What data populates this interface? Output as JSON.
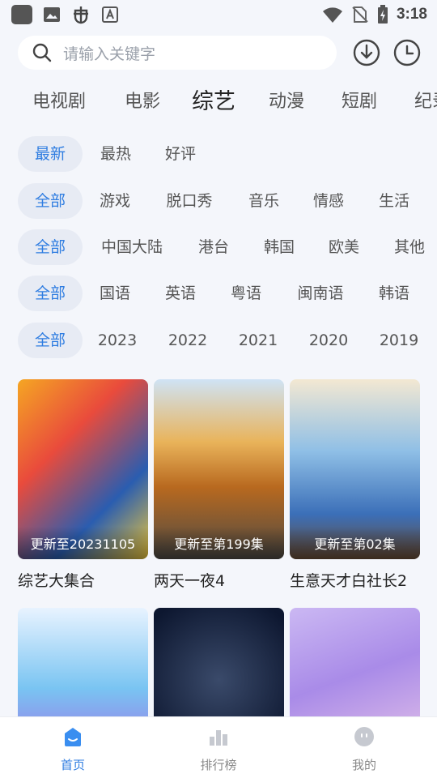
{
  "status_bar": {
    "time": "3:18"
  },
  "search": {
    "placeholder": "请输入关键字"
  },
  "category_tabs": [
    {
      "label": "电视剧"
    },
    {
      "label": "电影"
    },
    {
      "label": "综艺"
    },
    {
      "label": "动漫"
    },
    {
      "label": "短剧"
    },
    {
      "label": "纪录"
    }
  ],
  "active_category": "综艺",
  "filters": {
    "sort": [
      "最新",
      "最热",
      "好评"
    ],
    "genre": [
      "全部",
      "游戏",
      "脱口秀",
      "音乐",
      "情感",
      "生活"
    ],
    "region": [
      "全部",
      "中国大陆",
      "港台",
      "韩国",
      "欧美",
      "其他"
    ],
    "language": [
      "全部",
      "国语",
      "英语",
      "粤语",
      "闽南语",
      "韩语"
    ],
    "year": [
      "全部",
      "2023",
      "2022",
      "2021",
      "2020",
      "2019"
    ]
  },
  "shows": [
    {
      "title": "综艺大集合",
      "update": "更新至20231105"
    },
    {
      "title": "两天一夜4",
      "update": "更新至第199集"
    },
    {
      "title": "生意天才白社长2",
      "update": "更新至第02集"
    },
    {
      "title": "",
      "update": ""
    },
    {
      "title": "",
      "update": ""
    },
    {
      "title": "",
      "update": ""
    }
  ],
  "tabbar": [
    {
      "label": "首页",
      "icon": "home-icon"
    },
    {
      "label": "排行榜",
      "icon": "ranking-icon"
    },
    {
      "label": "我的",
      "icon": "profile-icon"
    }
  ],
  "colors": {
    "accent": "#2f7de1",
    "background": "#f4f6fb",
    "chip_selected_bg": "#e7ebf4"
  }
}
